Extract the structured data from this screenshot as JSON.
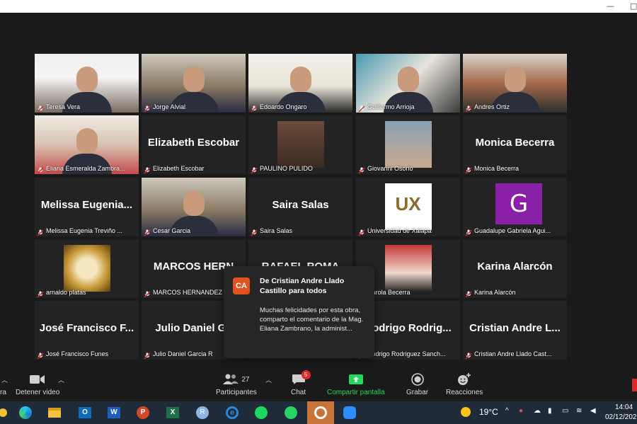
{
  "participants": [
    {
      "name": "Teresa Vera",
      "has_video": true
    },
    {
      "name": "Jorge Alvial",
      "has_video": true
    },
    {
      "name": "Edoardo Ongaro",
      "has_video": true,
      "active_speaker": true
    },
    {
      "name": "Guillermo Arrioja",
      "has_video": true
    },
    {
      "name": "Andres Ortiz",
      "has_video": true
    },
    {
      "name": "Eliana Esmeralda Zambra...",
      "has_video": true
    },
    {
      "name": "Elizabeth Escobar",
      "display": "Elizabeth Escobar",
      "has_video": false
    },
    {
      "name": "PAULINO PULIDO",
      "has_video": true
    },
    {
      "name": "Giovanni Osorio",
      "has_video": true
    },
    {
      "name": "Monica Becerra",
      "display": "Monica Becerra",
      "has_video": false
    },
    {
      "name": "Melissa Eugenia Treviño ...",
      "display": "Melissa Eugenia...",
      "has_video": false
    },
    {
      "name": "Cesar Garcia",
      "has_video": true
    },
    {
      "name": "Saira Salas",
      "display": "Saira Salas",
      "has_video": false
    },
    {
      "name": "Universidad de Xalapa",
      "has_video": true
    },
    {
      "name": "Guadalupe Gabriela Agui...",
      "avatar_letter": "G",
      "has_video": false
    },
    {
      "name": "arnaldo platas",
      "has_video": true
    },
    {
      "name": "MARCOS HERNANDEZ",
      "display": "MARCOS HERN",
      "has_video": false
    },
    {
      "name": "",
      "display": "RAFAEL ROMA",
      "has_video": false
    },
    {
      "name": "Carola Becerra",
      "has_video": true
    },
    {
      "name": "Karina Alarcón",
      "display": "Karina Alarcón",
      "has_video": false
    },
    {
      "name": "José Francisco Funes",
      "display": "José Francisco F...",
      "has_video": false
    },
    {
      "name": "Julio Daniel Garcia R",
      "display": "Julio Daniel Ga",
      "has_video": false
    },
    {
      "name": "",
      "has_video": false
    },
    {
      "name": "Rodrigo Rodriguez Sanch...",
      "display": "Rodrigo Rodrig...",
      "has_video": false
    },
    {
      "name": "Cristian Andre Llado Cast...",
      "display": "Cristian Andre L...",
      "has_video": false
    }
  ],
  "chat_popup": {
    "initials": "CA",
    "from": "De Cristian Andre Llado Castillo para todos",
    "message": "Muchas felicidades por esta obra, comparto el comentario de la Mag. Eliana Zambrano, la administ..."
  },
  "toolbar": {
    "audio_label": "ra",
    "video_label": "Detener video",
    "participants_label": "Participantes",
    "participants_count": "27",
    "chat_label": "Chat",
    "chat_badge": "5",
    "share_label": "Compartir pantalla",
    "record_label": "Grabar",
    "reactions_label": "Reacciones"
  },
  "taskbar": {
    "weather": "19°C",
    "time": "14:04",
    "date": "02/12/202"
  },
  "colors": {
    "active_speaker_border": "#c9e75f",
    "share_green": "#23d959",
    "badge_red": "#e02828",
    "taskbar_bg": "#202b3a"
  }
}
